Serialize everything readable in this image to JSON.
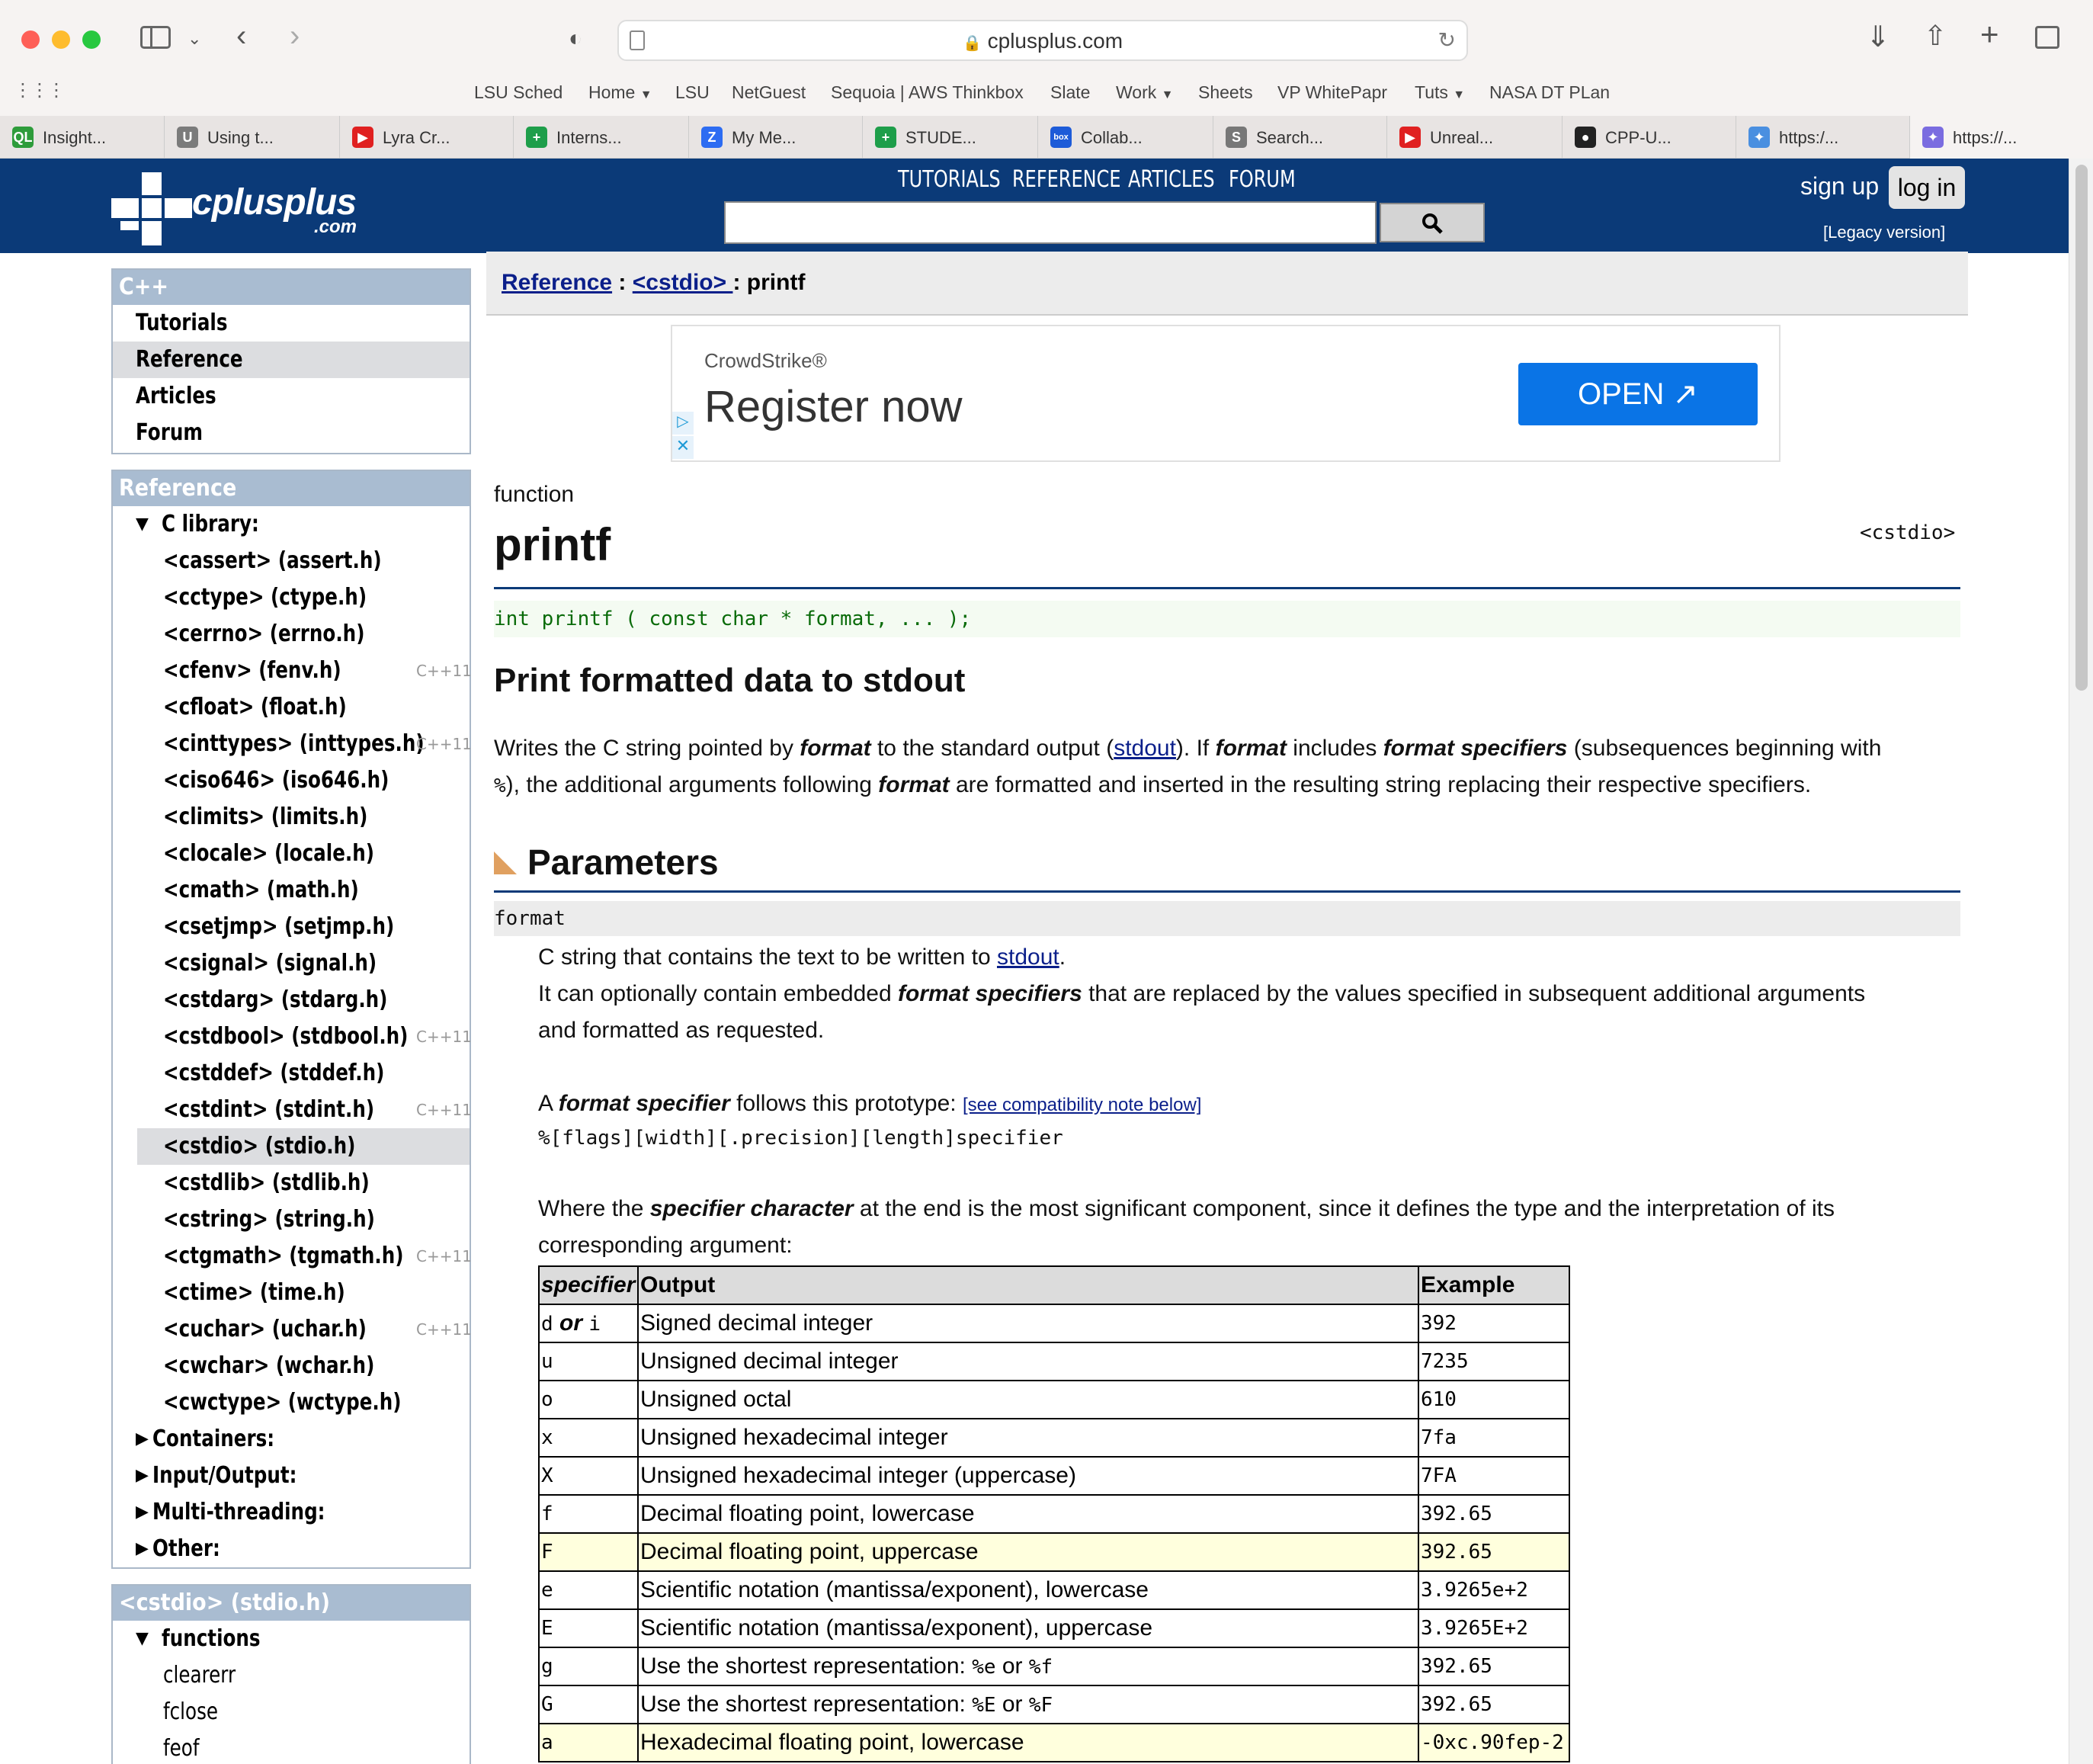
{
  "browser": {
    "url": "cplusplus.com",
    "favorites": [
      "LSU Sched",
      "Home",
      "LSU",
      "NetGuest",
      "Sequoia | AWS Thinkbox",
      "Slate",
      "Work",
      "Sheets",
      "VP WhitePapr",
      "Tuts",
      "NASA DT PLan"
    ],
    "tabs": [
      {
        "label": "Insight...",
        "icon": "QL",
        "color": "#2e9c3b"
      },
      {
        "label": "Using t...",
        "icon": "U",
        "color": "#7b7b7b"
      },
      {
        "label": "Lyra Cr...",
        "icon": "▶",
        "color": "#e02020"
      },
      {
        "label": "Interns...",
        "icon": "+",
        "color": "#1e9e4a"
      },
      {
        "label": "My Me...",
        "icon": "Z",
        "color": "#2d6cf2"
      },
      {
        "label": "STUDE...",
        "icon": "+",
        "color": "#1e9e4a"
      },
      {
        "label": "Collab...",
        "icon": "box",
        "color": "#1d5bd8"
      },
      {
        "label": "Search...",
        "icon": "S",
        "color": "#777"
      },
      {
        "label": "Unreal...",
        "icon": "▶",
        "color": "#e02020"
      },
      {
        "label": "CPP-U...",
        "icon": "●",
        "color": "#222"
      },
      {
        "label": "https:/...",
        "icon": "✦",
        "color": "#4a8fe0"
      },
      {
        "label": "https://...",
        "icon": "✦",
        "color": "#7a6ce0"
      }
    ]
  },
  "site": {
    "logo": "cplusplus",
    "logo_sub": ".com",
    "nav": [
      "TUTORIALS",
      "REFERENCE",
      "ARTICLES",
      "FORUM"
    ],
    "search_placeholder": "",
    "sign_up": "sign up",
    "log_in": "log in",
    "legacy": "[Legacy version]"
  },
  "sidebar": {
    "cpp_head": "C++",
    "cpp_items": [
      "Tutorials",
      "Reference",
      "Articles",
      "Forum"
    ],
    "ref_head": "Reference",
    "c_library": "C library:",
    "headers": [
      {
        "label": "<cassert> (assert.h)",
        "tag": ""
      },
      {
        "label": "<cctype> (ctype.h)",
        "tag": ""
      },
      {
        "label": "<cerrno> (errno.h)",
        "tag": ""
      },
      {
        "label": "<cfenv> (fenv.h)",
        "tag": "C++11"
      },
      {
        "label": "<cfloat> (float.h)",
        "tag": ""
      },
      {
        "label": "<cinttypes> (inttypes.h)",
        "tag": "C++11"
      },
      {
        "label": "<ciso646> (iso646.h)",
        "tag": ""
      },
      {
        "label": "<climits> (limits.h)",
        "tag": ""
      },
      {
        "label": "<clocale> (locale.h)",
        "tag": ""
      },
      {
        "label": "<cmath> (math.h)",
        "tag": ""
      },
      {
        "label": "<csetjmp> (setjmp.h)",
        "tag": ""
      },
      {
        "label": "<csignal> (signal.h)",
        "tag": ""
      },
      {
        "label": "<cstdarg> (stdarg.h)",
        "tag": ""
      },
      {
        "label": "<cstdbool> (stdbool.h)",
        "tag": "C++11"
      },
      {
        "label": "<cstddef> (stddef.h)",
        "tag": ""
      },
      {
        "label": "<cstdint> (stdint.h)",
        "tag": "C++11"
      },
      {
        "label": "<cstdio> (stdio.h)",
        "tag": ""
      },
      {
        "label": "<cstdlib> (stdlib.h)",
        "tag": ""
      },
      {
        "label": "<cstring> (string.h)",
        "tag": ""
      },
      {
        "label": "<ctgmath> (tgmath.h)",
        "tag": "C++11"
      },
      {
        "label": "<ctime> (time.h)",
        "tag": ""
      },
      {
        "label": "<cuchar> (uchar.h)",
        "tag": "C++11"
      },
      {
        "label": "<cwchar> (wchar.h)",
        "tag": ""
      },
      {
        "label": "<cwctype> (wctype.h)",
        "tag": ""
      }
    ],
    "selected_header": "<cstdio> (stdio.h)",
    "groups": [
      "Containers:",
      "Input/Output:",
      "Multi-threading:",
      "Other:"
    ],
    "stdio_head": "<cstdio> (stdio.h)",
    "functions_label": "functions",
    "functions": [
      "clearerr",
      "fclose",
      "feof"
    ]
  },
  "content": {
    "crumb_ref": "Reference",
    "crumb_sep": " : ",
    "crumb_header": "<cstdio> ",
    "crumb_sep2": ": ",
    "crumb_page": "printf",
    "ad": {
      "brand": "CrowdStrike®",
      "headline": "Register now",
      "cta": "OPEN"
    },
    "kind": "function",
    "title": "printf",
    "header_tag": "<cstdio>",
    "prototype": "int printf ( const char * format, ... );",
    "subtitle": "Print formatted data to stdout",
    "desc_1": "Writes the C string pointed by ",
    "desc_fmt": "format",
    "desc_2": " to the standard output (",
    "desc_stdout": "stdout",
    "desc_3": "). If ",
    "desc_4": " includes ",
    "desc_spec": "format specifiers",
    "desc_5": " (subsequences beginning with",
    "desc_pct": "%",
    "desc_6": "), the additional arguments following ",
    "desc_7": " are formatted and inserted in the resulting string replacing their respective specifiers.",
    "params_heading": "Parameters",
    "param_name": "format",
    "param_l1a": "C string that contains the text to be written to ",
    "param_l1b": ".",
    "param_l2a": "It can optionally contain embedded ",
    "param_l2b": " that are replaced by the values specified in subsequent additional arguments",
    "param_l3": "and formatted as requested.",
    "proto_a": "A ",
    "proto_b": "format specifier",
    "proto_c": " follows this prototype: ",
    "proto_link": "[see compatibility note below]",
    "proto_code": "%[flags][width][.precision][length]specifier",
    "where_a": "Where the ",
    "where_b": "specifier character",
    "where_c": " at the end is the most significant component, since it defines the type and the interpretation of its",
    "where_d": "corresponding argument:",
    "table": {
      "headers": [
        "specifier",
        "Output",
        "Example"
      ],
      "rows": [
        {
          "spec": "d or i",
          "out": "Signed decimal integer",
          "ex": "392",
          "hl": false
        },
        {
          "spec": "u",
          "out": "Unsigned decimal integer",
          "ex": "7235",
          "hl": false
        },
        {
          "spec": "o",
          "out": "Unsigned octal",
          "ex": "610",
          "hl": false
        },
        {
          "spec": "x",
          "out": "Unsigned hexadecimal integer",
          "ex": "7fa",
          "hl": false
        },
        {
          "spec": "X",
          "out": "Unsigned hexadecimal integer (uppercase)",
          "ex": "7FA",
          "hl": false
        },
        {
          "spec": "f",
          "out": "Decimal floating point, lowercase",
          "ex": "392.65",
          "hl": false
        },
        {
          "spec": "F",
          "out": "Decimal floating point, uppercase",
          "ex": "392.65",
          "hl": true
        },
        {
          "spec": "e",
          "out": "Scientific notation (mantissa/exponent), lowercase",
          "ex": "3.9265e+2",
          "hl": false
        },
        {
          "spec": "E",
          "out": "Scientific notation (mantissa/exponent), uppercase",
          "ex": "3.9265E+2",
          "hl": false
        },
        {
          "spec": "g",
          "out": "Use the shortest representation: %e or %f",
          "ex": "392.65",
          "hl": false
        },
        {
          "spec": "G",
          "out": "Use the shortest representation: %E or %F",
          "ex": "392.65",
          "hl": false
        },
        {
          "spec": "a",
          "out": "Hexadecimal floating point, lowercase",
          "ex": "-0xc.90fep-2",
          "hl": true
        }
      ]
    }
  }
}
